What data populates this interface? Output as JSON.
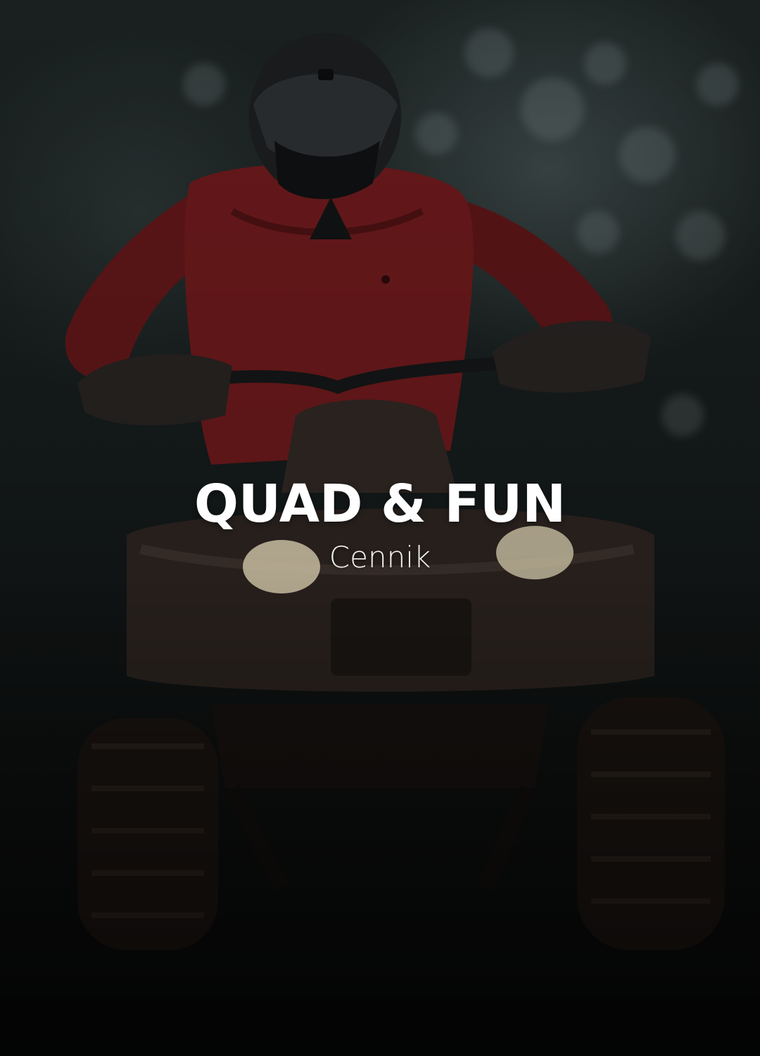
{
  "hero": {
    "title": "QUAD & FUN",
    "subtitle": "Cennik"
  },
  "colors": {
    "jacket": "#6e1a1c",
    "helmet": "#1a1c1e",
    "mud": "#3a2f2a",
    "headlight": "#f3e6c2",
    "text": "#ffffff"
  }
}
